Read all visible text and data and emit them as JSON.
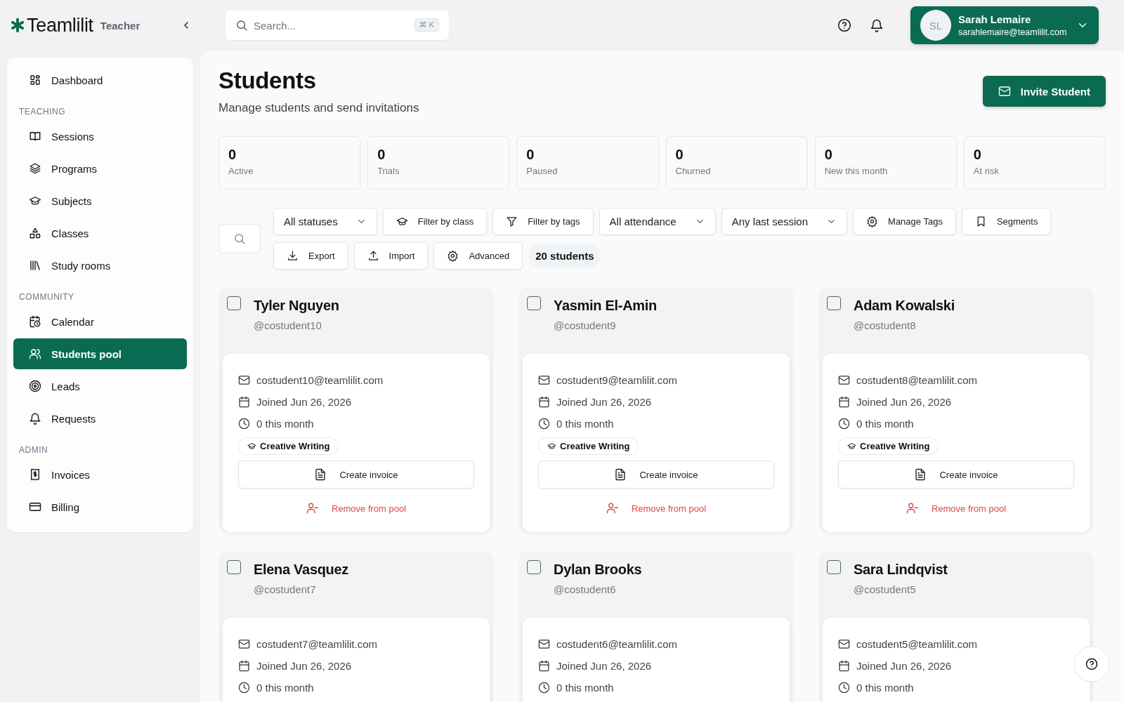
{
  "brand": {
    "name": "Teamlilit",
    "role": "Teacher"
  },
  "search": {
    "placeholder": "Search...",
    "shortcut": "⌘ K"
  },
  "user": {
    "initials": "SL",
    "name": "Sarah Lemaire",
    "email": "sarahlemaire@teamlilit.com"
  },
  "sidebar": [
    {
      "items": [
        {
          "label": "Dashboard",
          "selected": false
        }
      ]
    },
    {
      "heading": "TEACHING",
      "items": [
        {
          "label": "Sessions",
          "selected": false
        },
        {
          "label": "Programs",
          "selected": false
        },
        {
          "label": "Subjects",
          "selected": false
        },
        {
          "label": "Classes",
          "selected": false
        },
        {
          "label": "Study rooms",
          "selected": false
        }
      ]
    },
    {
      "heading": "COMMUNITY",
      "items": [
        {
          "label": "Calendar",
          "selected": false
        },
        {
          "label": "Students pool",
          "selected": true
        },
        {
          "label": "Leads",
          "selected": false
        },
        {
          "label": "Requests",
          "selected": false
        }
      ]
    },
    {
      "heading": "ADMIN",
      "items": [
        {
          "label": "Invoices",
          "selected": false
        },
        {
          "label": "Billing",
          "selected": false
        }
      ]
    }
  ],
  "page": {
    "title": "Students",
    "subtitle": "Manage students and send invitations",
    "action": "Invite Student"
  },
  "stats": [
    {
      "value": "0",
      "label": "Active"
    },
    {
      "value": "0",
      "label": "Trials"
    },
    {
      "value": "0",
      "label": "Paused"
    },
    {
      "value": "0",
      "label": "Churned"
    },
    {
      "value": "0",
      "label": "New this month"
    },
    {
      "value": "0",
      "label": "At risk"
    }
  ],
  "filters": [
    {
      "kind": "select",
      "label": "All statuses"
    },
    {
      "kind": "class",
      "label": "Filter by class"
    },
    {
      "kind": "tags",
      "label": "Filter by tags"
    },
    {
      "kind": "select",
      "label": "All attendance"
    },
    {
      "kind": "select",
      "label": "Any last session"
    },
    {
      "kind": "manage",
      "label": "Manage Tags"
    },
    {
      "kind": "segments",
      "label": "Segments"
    },
    {
      "kind": "export",
      "label": "Export"
    },
    {
      "kind": "import",
      "label": "Import"
    },
    {
      "kind": "advanced",
      "label": "Advanced"
    },
    {
      "kind": "count",
      "label": "20 students"
    }
  ],
  "students": [
    {
      "checked": false,
      "name": "Tyler Nguyen",
      "handle": "@costudent10",
      "email": "costudent10@teamlilit.com",
      "joined": "Joined Jun 26, 2026",
      "sessions": "0 this month",
      "tag": "Creative Writing",
      "invoice": "Create invoice",
      "remove": "Remove from pool"
    },
    {
      "checked": false,
      "name": "Yasmin El-Amin",
      "handle": "@costudent9",
      "email": "costudent9@teamlilit.com",
      "joined": "Joined Jun 26, 2026",
      "sessions": "0 this month",
      "tag": "Creative Writing",
      "invoice": "Create invoice",
      "remove": "Remove from pool"
    },
    {
      "checked": false,
      "name": "Adam Kowalski",
      "handle": "@costudent8",
      "email": "costudent8@teamlilit.com",
      "joined": "Joined Jun 26, 2026",
      "sessions": "0 this month",
      "tag": "Creative Writing",
      "invoice": "Create invoice",
      "remove": "Remove from pool"
    },
    {
      "checked": false,
      "name": "Elena Vasquez",
      "handle": "@costudent7",
      "email": "costudent7@teamlilit.com",
      "joined": "Joined Jun 26, 2026",
      "sessions": "0 this month"
    },
    {
      "checked": false,
      "name": "Dylan Brooks",
      "handle": "@costudent6",
      "email": "costudent6@teamlilit.com",
      "joined": "Joined Jun 26, 2026",
      "sessions": "0 this month"
    },
    {
      "checked": false,
      "name": "Sara Lindqvist",
      "handle": "@costudent5",
      "email": "costudent5@teamlilit.com",
      "joined": "Joined Jun 26, 2026",
      "sessions": "0 this month"
    }
  ]
}
